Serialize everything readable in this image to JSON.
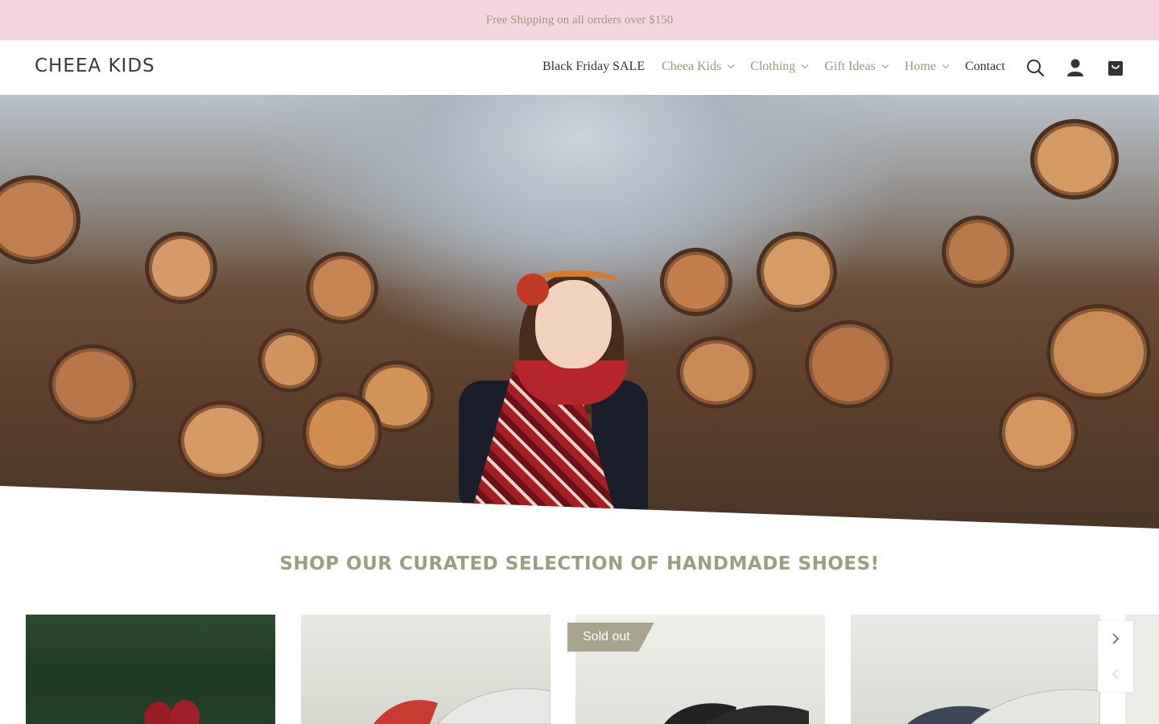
{
  "announcement": {
    "text": "Free Shipping on all orrders over $150"
  },
  "header": {
    "logo": "CHEEA KIDS",
    "nav": [
      {
        "label": "Black Friday SALE",
        "has_dropdown": false
      },
      {
        "label": "Cheea Kids",
        "has_dropdown": true
      },
      {
        "label": "Clothing",
        "has_dropdown": true
      },
      {
        "label": "Gift Ideas",
        "has_dropdown": true
      },
      {
        "label": "Home",
        "has_dropdown": true
      },
      {
        "label": "Contact",
        "has_dropdown": false
      }
    ],
    "icons": [
      "search-icon",
      "account-icon",
      "cart-icon"
    ]
  },
  "hero": {
    "image": "girl-in-red-dress-by-log-pile"
  },
  "collection": {
    "title": "SHOP OUR CURATED SELECTION OF HANDMADE SHOES!",
    "products": [
      {
        "image": "red-shoes-on-pine-branches",
        "sold_out": false
      },
      {
        "image": "red-sandal",
        "sold_out": false
      },
      {
        "image": "black-mary-janes",
        "sold_out": true,
        "badge": "Sold out"
      },
      {
        "image": "navy-sandal",
        "sold_out": false
      }
    ],
    "controls": {
      "next": "chevron-right-icon",
      "prev": "chevron-left-icon"
    }
  },
  "colors": {
    "announcement_bg": "#f6d6de",
    "nav_text": "#9a9a80",
    "accent_title": "#9aa07f",
    "badge_bg": "#a7a48e"
  }
}
